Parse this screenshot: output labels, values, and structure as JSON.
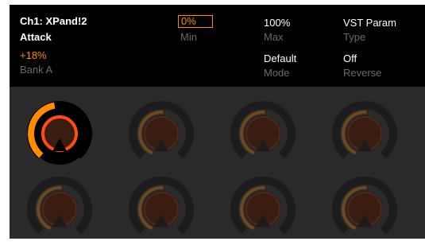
{
  "header": {
    "channel_title": "Ch1: XPand!2",
    "param_name": "Attack",
    "param_value": "+18%",
    "bank": "Bank A",
    "min": {
      "value": "0%",
      "label": "Min"
    },
    "max": {
      "value": "100%",
      "label": "Max"
    },
    "type": {
      "value": "VST Param",
      "label": "Type"
    },
    "mode": {
      "value": "Default",
      "label": "Mode"
    },
    "reverse": {
      "value": "Off",
      "label": "Reverse"
    }
  },
  "knobs": [
    {
      "active": true,
      "value": 0.18
    },
    {
      "active": false,
      "value": 0.0
    },
    {
      "active": false,
      "value": 0.0
    },
    {
      "active": false,
      "value": 0.0
    },
    {
      "active": false,
      "value": 0.0
    },
    {
      "active": false,
      "value": 0.0
    },
    {
      "active": false,
      "value": 0.0
    },
    {
      "active": false,
      "value": 0.0
    }
  ],
  "colors": {
    "accent": "#ff8c00",
    "inactive_ring": "#6b4a1f",
    "active_inner": "#ff4a1a",
    "knob_fill": "#3a1c10"
  }
}
